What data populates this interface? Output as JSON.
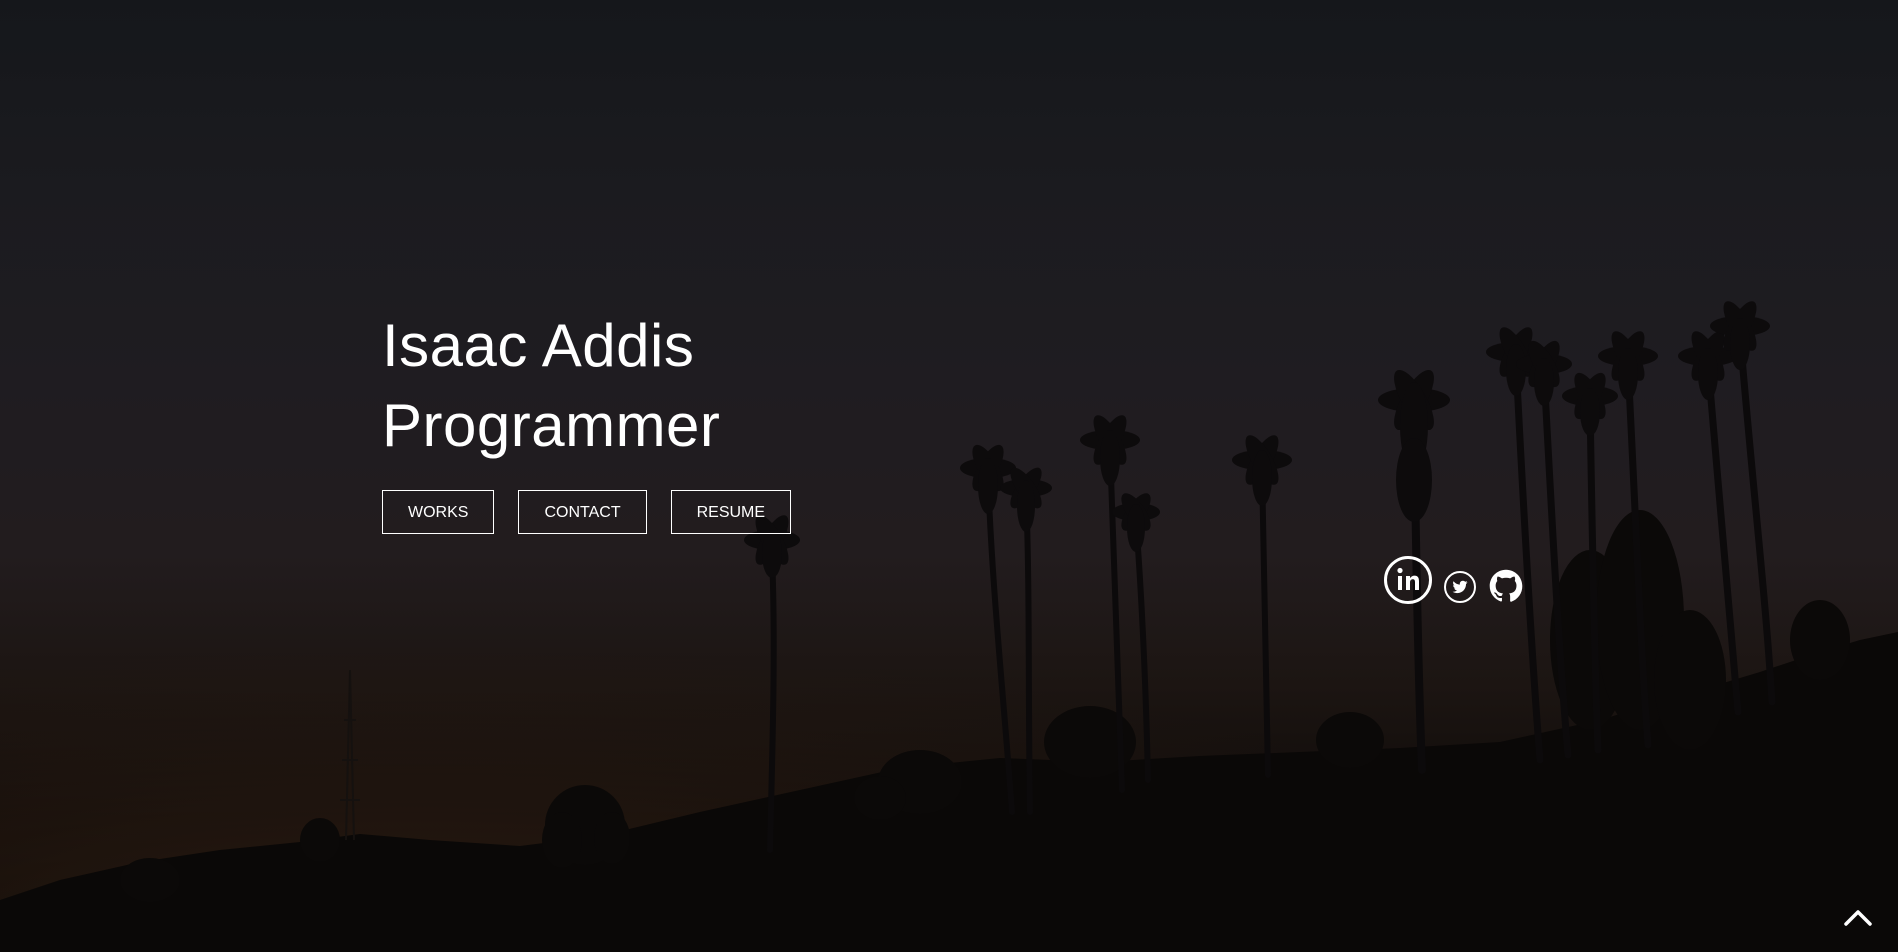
{
  "hero": {
    "name": "Isaac Addis",
    "role": "Programmer"
  },
  "buttons": {
    "works_label": "WORKS",
    "contact_label": "CONTACT",
    "resume_label": "RESUME"
  },
  "social": [
    {
      "name": "LinkedIn",
      "icon": "linkedin-icon"
    },
    {
      "name": "Twitter",
      "icon": "twitter-icon"
    },
    {
      "name": "GitHub",
      "icon": "github-icon"
    }
  ],
  "scroll_top": {
    "icon": "chevron-up-icon"
  },
  "colors": {
    "text": "#ffffff",
    "sky_top": "#15171b",
    "sky_mid": "#221c1e",
    "ground": "#070605"
  }
}
